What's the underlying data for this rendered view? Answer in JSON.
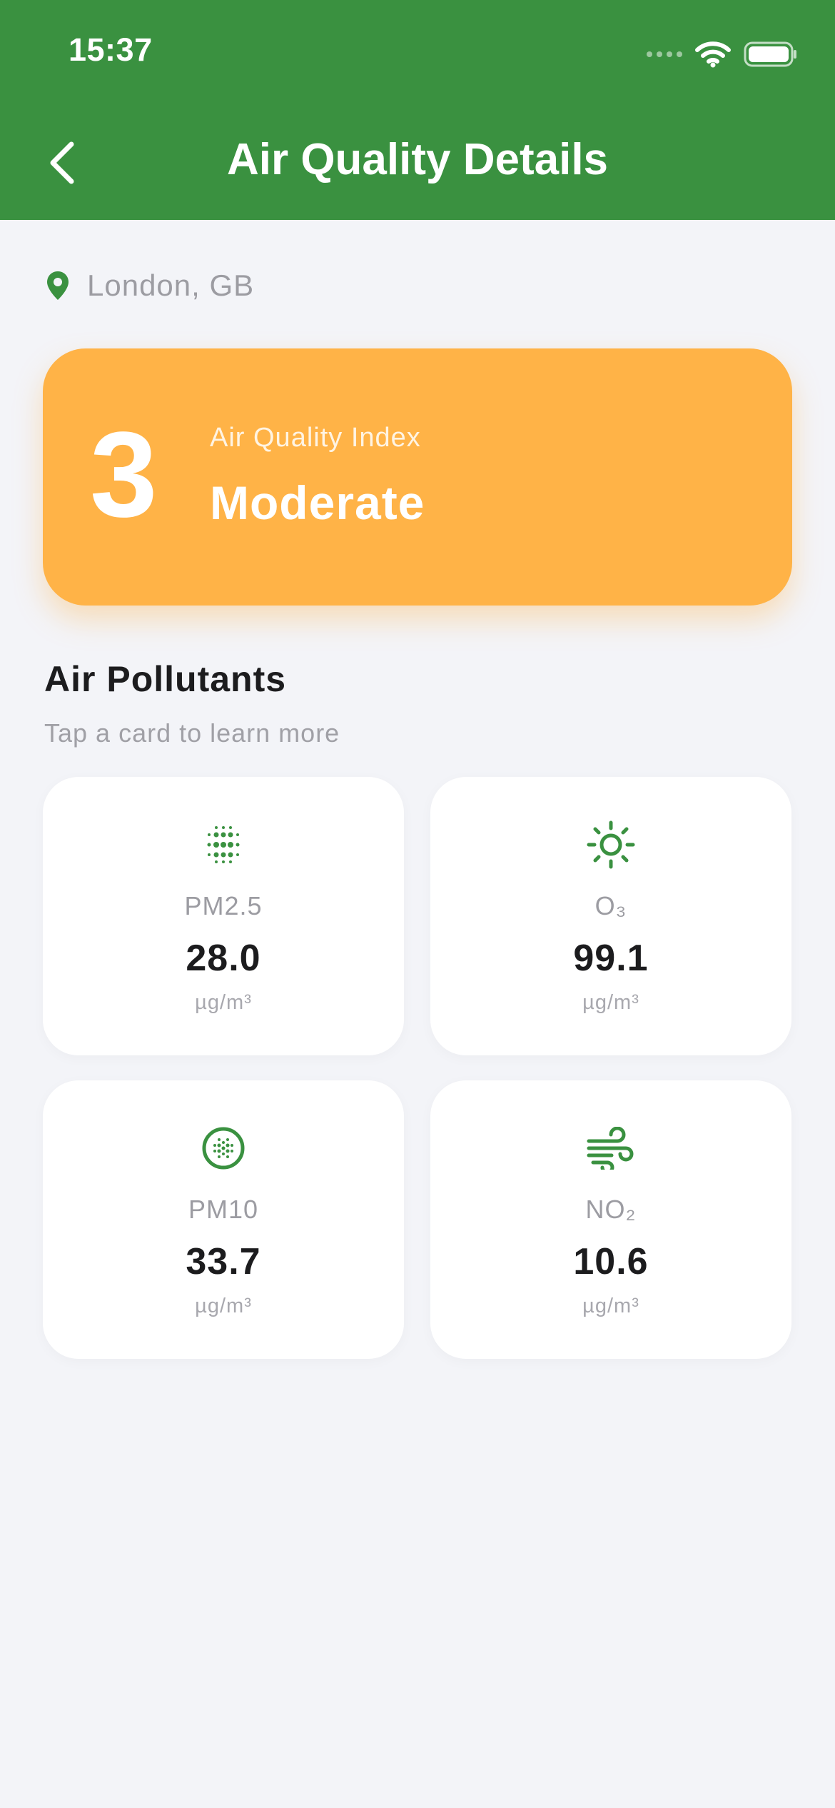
{
  "colors": {
    "header": "#3A9140",
    "accent_green": "#3A9140",
    "aqi_card": "#FFB347",
    "background": "#F3F4F8"
  },
  "status_bar": {
    "time": "15:37"
  },
  "nav": {
    "title": "Air Quality Details",
    "back_icon": "chevron-left-icon"
  },
  "location": {
    "icon": "map-pin-icon",
    "text": "London, GB"
  },
  "aqi": {
    "value": "3",
    "label": "Air Quality Index",
    "status": "Moderate"
  },
  "pollutants_section": {
    "title": "Air Pollutants",
    "subtitle": "Tap a card to learn more"
  },
  "pollutants": [
    {
      "icon": "dots-grid-icon",
      "name": "PM2.5",
      "value": "28.0",
      "unit": "µg/m³"
    },
    {
      "icon": "sun-icon",
      "name": "O₃",
      "value": "99.1",
      "unit": "µg/m³"
    },
    {
      "icon": "dotted-circle-icon",
      "name": "PM10",
      "value": "33.7",
      "unit": "µg/m³"
    },
    {
      "icon": "wind-icon",
      "name": "NO₂",
      "value": "10.6",
      "unit": "µg/m³"
    }
  ]
}
